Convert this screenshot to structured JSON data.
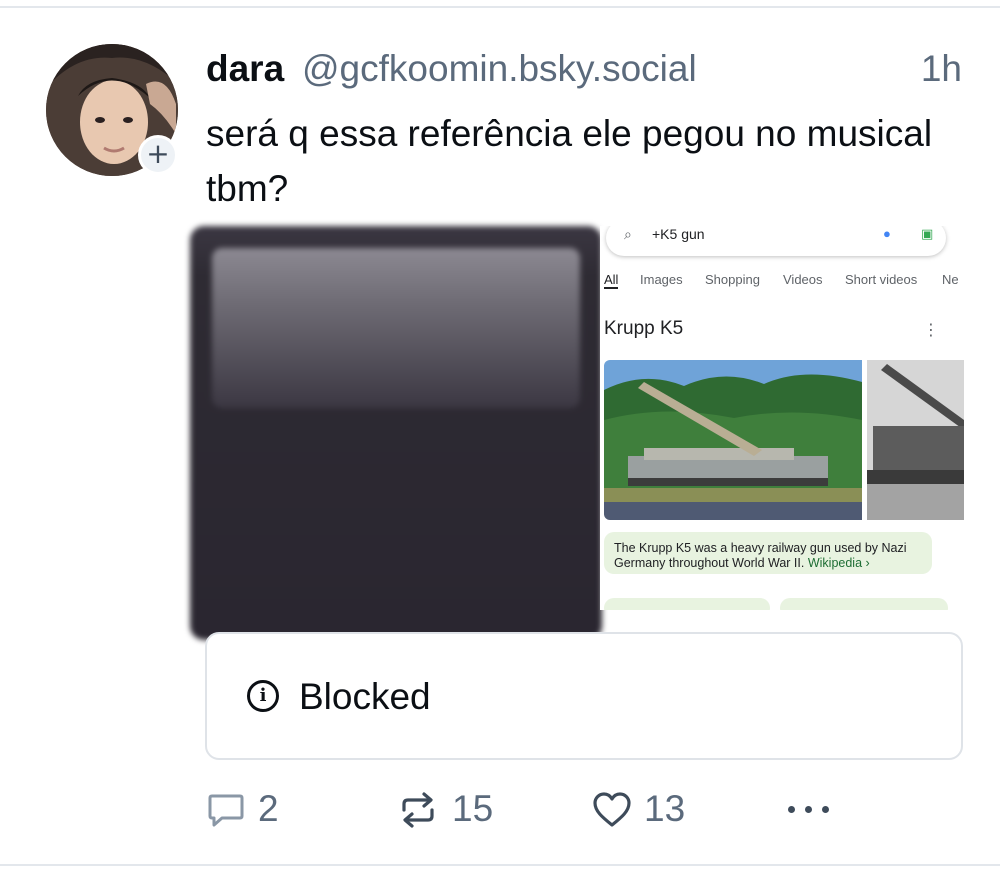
{
  "post": {
    "author": {
      "display_name": "dara",
      "handle": "@gcfkoomin.bsky.social",
      "follow_glyph": "+"
    },
    "timestamp": "1h",
    "text": "será q essa referência ele pegou no musical tbm?",
    "embedded_screenshot": {
      "query": "+K5 gun",
      "tabs": [
        "All",
        "Images",
        "Shopping",
        "Videos",
        "Short videos",
        "Ne"
      ],
      "title": "Krupp K5",
      "description": "The Krupp K5 was a heavy railway gun used by Nazi Germany throughout World War II.",
      "source_link": "Wikipedia ›"
    },
    "blocked_label": "Blocked",
    "actions": {
      "replies": "2",
      "reposts": "15",
      "likes": "13"
    }
  },
  "icons": {
    "reply": "speech-bubble-icon",
    "repost": "repost-arrows-icon",
    "like": "heart-icon",
    "more": "ellipsis-icon",
    "blocked": "info-icon"
  },
  "colors": {
    "text_primary": "#0b0f14",
    "text_secondary": "#5b6a7c",
    "icon": "#3e4b5a",
    "border": "#dfe3e8",
    "kp_green": "#e8f3e0"
  }
}
